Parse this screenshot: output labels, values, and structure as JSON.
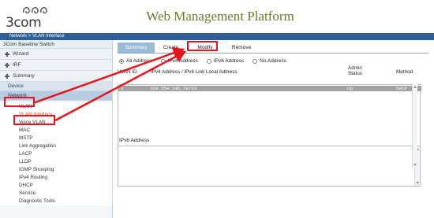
{
  "logo": {
    "text": "3com"
  },
  "header": {
    "title": "Web Management Platform"
  },
  "breadcrumb": {
    "text": "Network > VLAN Interface"
  },
  "sidebar": {
    "device_title": "3Com Baseline Switch",
    "groups": [
      {
        "label": "Wizard"
      },
      {
        "label": "IRF"
      },
      {
        "label": "Summary"
      }
    ],
    "device_section": "Device",
    "network_section": "Network",
    "items": [
      {
        "label": "VLAN"
      },
      {
        "label": "VLAN Interface"
      },
      {
        "label": "Voice VLAN"
      },
      {
        "label": "MAC"
      },
      {
        "label": "MSTP"
      },
      {
        "label": "Link Aggregation"
      },
      {
        "label": "LACP"
      },
      {
        "label": "LLDP"
      },
      {
        "label": "IGMP Snooping"
      },
      {
        "label": "IPv4 Routing"
      },
      {
        "label": "DHCP"
      },
      {
        "label": "Service"
      },
      {
        "label": "Diagnostic Tools"
      }
    ]
  },
  "tabs": [
    {
      "label": "Summary"
    },
    {
      "label": "Create"
    },
    {
      "label": "Modify"
    },
    {
      "label": "Remove"
    }
  ],
  "filter": {
    "options": [
      {
        "label": "All Address",
        "selected": true
      },
      {
        "label": "IPv4 Address",
        "selected": false
      },
      {
        "label": "IPv6 Address",
        "selected": false
      },
      {
        "label": "No Address",
        "selected": false
      }
    ]
  },
  "table": {
    "columns": {
      "vlan_id": "VLAN ID",
      "address": "IPv4 Address / IPv6 Link Local Address",
      "admin_status": "Admin Status",
      "method": "Method"
    },
    "rows": [
      {
        "vlan_id": "1",
        "address": "169.254.145.79/16",
        "admin_status": "Up",
        "method": "DHCP"
      }
    ]
  },
  "ipv6": {
    "label": "IPv6 Address"
  },
  "annotation": {
    "color": "#e8141b"
  }
}
